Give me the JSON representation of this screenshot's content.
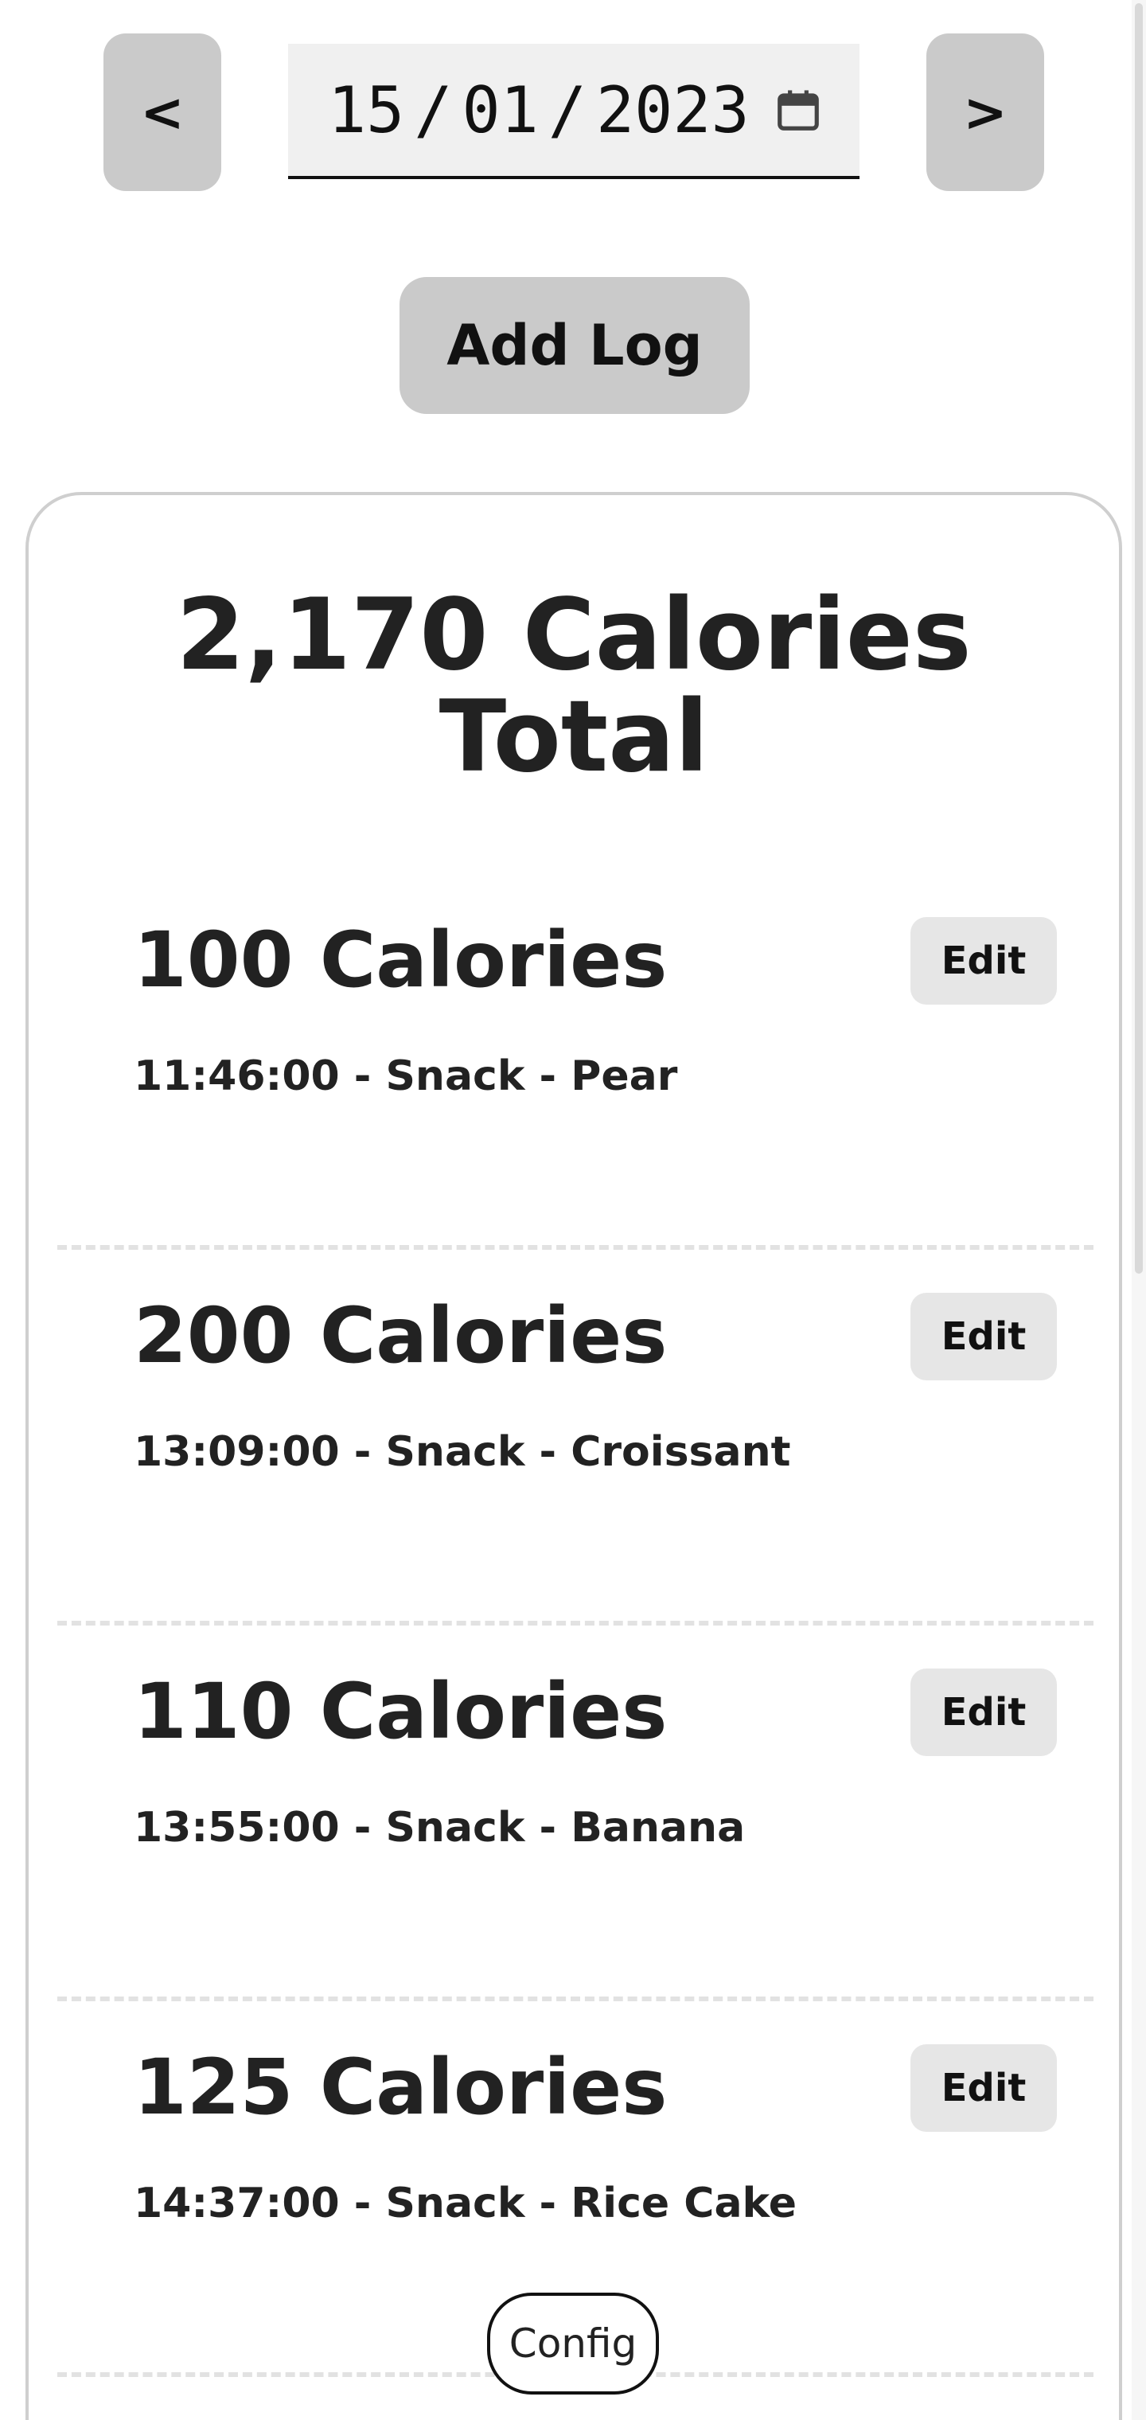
{
  "nav": {
    "prev_label": "<",
    "next_label": ">"
  },
  "date": {
    "day": "15",
    "month": "01",
    "year": "2023",
    "separator": "/",
    "icon": "calendar-icon"
  },
  "actions": {
    "add_log_label": "Add Log",
    "config_label": "Config"
  },
  "summary": {
    "total_line1": "2,170 Calories",
    "total_line2": "Total"
  },
  "logs": [
    {
      "calories": "100 Calories",
      "detail": "11:46:00 - Snack - Pear",
      "edit_label": "Edit"
    },
    {
      "calories": "200 Calories",
      "detail": "13:09:00 - Snack - Croissant",
      "edit_label": "Edit"
    },
    {
      "calories": "110 Calories",
      "detail": "13:55:00 - Snack - Banana",
      "edit_label": "Edit"
    },
    {
      "calories": "125 Calories",
      "detail": "14:37:00 - Snack - Rice Cake",
      "edit_label": "Edit"
    }
  ]
}
